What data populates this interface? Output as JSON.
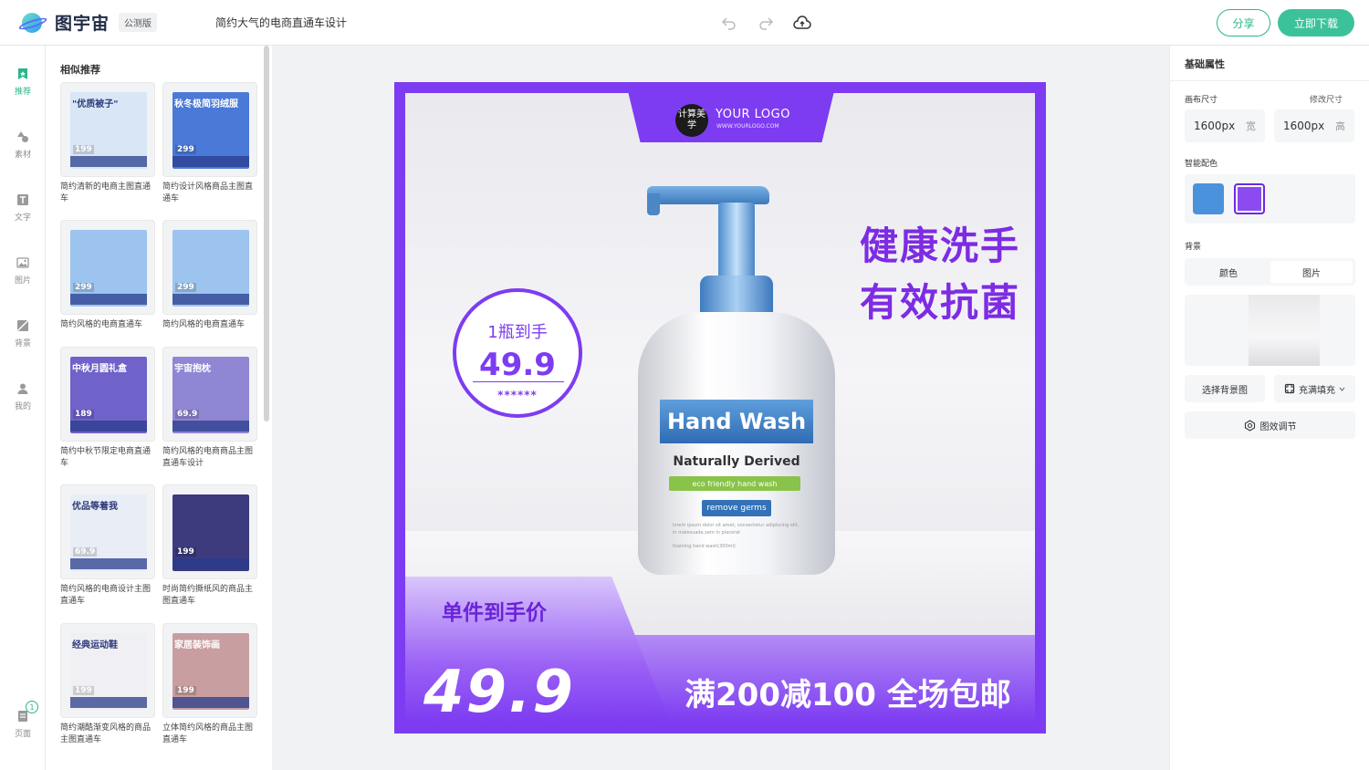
{
  "app": {
    "name": "图宇宙",
    "badge": "公测版",
    "doc_title": "简约大气的电商直通车设计",
    "share_label": "分享",
    "download_label": "立即下载"
  },
  "left_nav": {
    "items": [
      {
        "label": "推荐",
        "icon": "recommend-icon",
        "active": true
      },
      {
        "label": "素材",
        "icon": "shapes-icon"
      },
      {
        "label": "文字",
        "icon": "text-icon"
      },
      {
        "label": "图片",
        "icon": "image-icon"
      },
      {
        "label": "背景",
        "icon": "background-icon"
      },
      {
        "label": "我的",
        "icon": "user-icon"
      }
    ],
    "pages_label": "页面",
    "pages_count": "1"
  },
  "templates": {
    "title": "相似推荐",
    "items": [
      {
        "name": "简约清新的电商主图直通车",
        "headline": "\"优质被子\"",
        "price": "199",
        "color": "#d8e6f5"
      },
      {
        "name": "简约设计风格商品主图直通车",
        "headline": "秋冬极简羽绒服",
        "price": "299",
        "color": "#4a79d8"
      },
      {
        "name": "简约风格的电商直通车",
        "headline": "",
        "price": "299",
        "color": "#9cc4ee"
      },
      {
        "name": "简约风格的电商直通车",
        "headline": "",
        "price": "299",
        "color": "#9cc4ee"
      },
      {
        "name": "简约中秋节限定电商直通车",
        "headline": "中秋月圆礼盒",
        "price": "189",
        "color": "#6f62c9"
      },
      {
        "name": "简约风格的电商商品主图直通车设计",
        "headline": "宇宙抱枕",
        "price": "69.9",
        "color": "#8f86d4"
      },
      {
        "name": "简约风格的电商设计主图直通车",
        "headline": "优品等着我",
        "price": "69.9",
        "color": "#e9edf5"
      },
      {
        "name": "时尚简约撕纸风的商品主图直通车",
        "headline": "",
        "price": "199",
        "color": "#3d3a7e"
      },
      {
        "name": "简约潮酷渐变风格的商品主图直通车",
        "headline": "经典运动鞋",
        "price": "199",
        "color": "#f0f0f4"
      },
      {
        "name": "立体简约风格的商品主图直通车",
        "headline": "家居装饰画",
        "price": "199",
        "color": "#c89ea0"
      }
    ]
  },
  "canvas": {
    "logo_circle": "计算美学",
    "logo_text": "YOUR LOGO",
    "logo_url": "WWW.YOURLOGO.COM",
    "headline_1": "健康洗手",
    "headline_2": "有效抗菌",
    "circle_top": "1瓶到手",
    "circle_price": "49.9",
    "circle_stars": "******",
    "product": {
      "name": "Hand Wash",
      "sub": "Naturally Derived",
      "eco": "eco friendly hand wash",
      "germs": "remove germs",
      "lorem": "lorem ipsum dolor sit amet, consectetur adipiscing elit, in malesuada,sem in placerat",
      "foaming": "foaming hand wash(300ml)"
    },
    "unit_price_label": "单件到手价",
    "big_price": "49.9",
    "promo": "满200减100 全场包邮",
    "colors": {
      "accent": "#7d3cf2",
      "headline": "#7d2ce3"
    }
  },
  "properties": {
    "title": "基础属性",
    "canvas_size_label": "画布尺寸",
    "resize_label": "修改尺寸",
    "width_value": "1600px",
    "width_unit": "宽",
    "height_value": "1600px",
    "height_unit": "高",
    "smart_color_label": "智能配色",
    "swatches": [
      "#4a92dc",
      "#8b4bf0"
    ],
    "background_label": "背景",
    "bg_tab_color": "颜色",
    "bg_tab_image": "图片",
    "choose_bg": "选择背景图",
    "fill_mode": "充满填充",
    "effects": "图效调节"
  }
}
